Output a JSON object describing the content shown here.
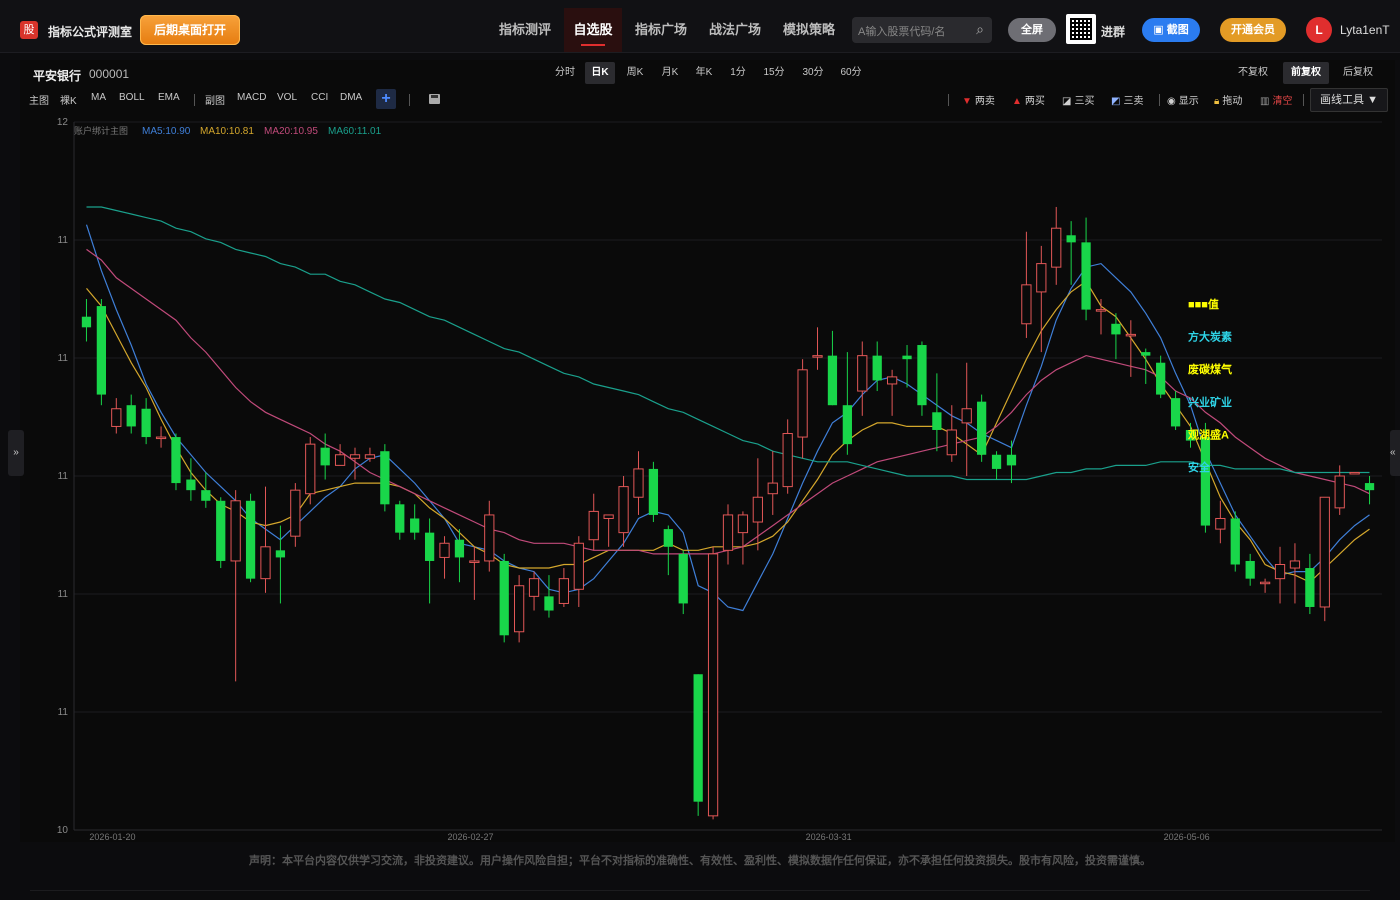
{
  "app": {
    "logo_char": "股",
    "brand": "指标公式评测室",
    "open_desktop": "后期桌面打开"
  },
  "nav": [
    {
      "label": "指标测评",
      "active": false
    },
    {
      "label": "自选股",
      "active": true
    },
    {
      "label": "指标广场",
      "active": false
    },
    {
      "label": "战法广场",
      "active": false
    },
    {
      "label": "模拟策略",
      "active": false
    }
  ],
  "search": {
    "placeholder": "A输入股票代码/名",
    "icon": "search-icon"
  },
  "buttons": {
    "fullscreen": "全屏",
    "join_group": "进群",
    "screenshot": "截图",
    "vip": "开通会员"
  },
  "user": {
    "initial": "L",
    "name": "Lyta1enT"
  },
  "stock": {
    "name": "平安银行",
    "code": "000001"
  },
  "periods": [
    "分时",
    "日K",
    "周K",
    "月K",
    "年K",
    "1分",
    "15分",
    "30分",
    "60分"
  ],
  "active_period": "日K",
  "adjust": [
    "不复权",
    "前复权",
    "后复权"
  ],
  "active_adjust": "前复权",
  "indicators_main": [
    "主图",
    "裸K",
    "MA",
    "BOLL",
    "EMA"
  ],
  "indicators_sub": [
    "副图",
    "MACD",
    "VOL",
    "CCI",
    "DMA"
  ],
  "plus": "+",
  "tools": [
    {
      "label": "两卖",
      "icon": "triangle-down-icon",
      "color": "#e02e2e"
    },
    {
      "label": "两买",
      "icon": "triangle-up-icon",
      "color": "#e02e2e"
    },
    {
      "label": "三买",
      "icon": "diagonal-line-icon",
      "color": "#ffffff"
    },
    {
      "label": "三卖",
      "icon": "diagonal-line-icon",
      "color": "#8fb3ff"
    },
    {
      "label": "显示",
      "icon": "eye-icon",
      "color": "#ffffff"
    },
    {
      "label": "拖动",
      "icon": "lock-icon",
      "color": "#f0c040"
    },
    {
      "label": "清空",
      "icon": "trash-icon",
      "color": "#e02e2e"
    }
  ],
  "draw_tools": "画线工具 ▼",
  "legend": {
    "title": "账户绑计主图",
    "ma5": "MA5:10.90",
    "ma10": "MA10:10.81",
    "ma20": "MA20:10.95",
    "ma60": "MA60:11.01"
  },
  "colors": {
    "up": "#e25757",
    "down": "#19d64a",
    "ma5": "#3f7fd8",
    "ma10": "#d4a72c",
    "ma20": "#c04a7a",
    "ma60": "#1aa08c",
    "annot_yellow": "#ffff00",
    "annot_cyan": "#2ed3e6"
  },
  "annotations": [
    {
      "text": "■■■值",
      "color": "yellow"
    },
    {
      "text": "方大炭素",
      "color": "cyan"
    },
    {
      "text": "废碳煤气",
      "color": "yellow"
    },
    {
      "text": "兴业矿业",
      "color": "cyan"
    },
    {
      "text": "观湖盛A",
      "color": "yellow"
    },
    {
      "text": "安全",
      "color": "cyan"
    }
  ],
  "chart_data": {
    "type": "candlestick",
    "y_tick_labels": [
      "12",
      "11",
      "11",
      "11",
      "11",
      "11",
      "10"
    ],
    "x_tick_labels": [
      "2026-01-20",
      "2026-02-27",
      "2026-03-31",
      "2026-05-06"
    ],
    "ylim": [
      10.0,
      12.0
    ],
    "candles": [
      {
        "o": 11.45,
        "c": 11.42,
        "h": 11.5,
        "l": 11.38
      },
      {
        "o": 11.48,
        "c": 11.23,
        "h": 11.5,
        "l": 11.2
      },
      {
        "o": 11.14,
        "c": 11.19,
        "h": 11.22,
        "l": 11.12
      },
      {
        "o": 11.2,
        "c": 11.14,
        "h": 11.23,
        "l": 11.12
      },
      {
        "o": 11.19,
        "c": 11.11,
        "h": 11.22,
        "l": 11.09
      },
      {
        "o": 11.11,
        "c": 11.11,
        "h": 11.14,
        "l": 11.08
      },
      {
        "o": 11.11,
        "c": 10.98,
        "h": 11.12,
        "l": 10.96
      },
      {
        "o": 10.99,
        "c": 10.96,
        "h": 11.05,
        "l": 10.93
      },
      {
        "o": 10.96,
        "c": 10.93,
        "h": 11.01,
        "l": 10.91
      },
      {
        "o": 10.93,
        "c": 10.76,
        "h": 10.94,
        "l": 10.74
      },
      {
        "o": 10.76,
        "c": 10.93,
        "h": 10.96,
        "l": 10.42
      },
      {
        "o": 10.93,
        "c": 10.71,
        "h": 10.95,
        "l": 10.7
      },
      {
        "o": 10.71,
        "c": 10.8,
        "h": 10.97,
        "l": 10.67
      },
      {
        "o": 10.79,
        "c": 10.77,
        "h": 10.86,
        "l": 10.64
      },
      {
        "o": 10.83,
        "c": 10.96,
        "h": 10.98,
        "l": 10.8
      },
      {
        "o": 10.95,
        "c": 11.09,
        "h": 11.11,
        "l": 10.92
      },
      {
        "o": 11.08,
        "c": 11.03,
        "h": 11.12,
        "l": 10.99
      },
      {
        "o": 11.03,
        "c": 11.06,
        "h": 11.09,
        "l": 11.03
      },
      {
        "o": 11.05,
        "c": 11.06,
        "h": 11.08,
        "l": 10.99
      },
      {
        "o": 11.05,
        "c": 11.06,
        "h": 11.08,
        "l": 11.04
      },
      {
        "o": 11.07,
        "c": 10.92,
        "h": 11.09,
        "l": 10.9
      },
      {
        "o": 10.92,
        "c": 10.84,
        "h": 10.93,
        "l": 10.82
      },
      {
        "o": 10.88,
        "c": 10.84,
        "h": 10.92,
        "l": 10.82
      },
      {
        "o": 10.84,
        "c": 10.76,
        "h": 10.88,
        "l": 10.64
      },
      {
        "o": 10.77,
        "c": 10.81,
        "h": 10.83,
        "l": 10.71
      },
      {
        "o": 10.82,
        "c": 10.77,
        "h": 10.85,
        "l": 10.7
      },
      {
        "o": 10.76,
        "c": 10.76,
        "h": 10.8,
        "l": 10.65
      },
      {
        "o": 10.76,
        "c": 10.89,
        "h": 10.93,
        "l": 10.73
      },
      {
        "o": 10.76,
        "c": 10.55,
        "h": 10.78,
        "l": 10.53
      },
      {
        "o": 10.56,
        "c": 10.69,
        "h": 10.72,
        "l": 10.53
      },
      {
        "o": 10.66,
        "c": 10.71,
        "h": 10.73,
        "l": 10.62
      },
      {
        "o": 10.66,
        "c": 10.62,
        "h": 10.72,
        "l": 10.6
      },
      {
        "o": 10.64,
        "c": 10.71,
        "h": 10.74,
        "l": 10.63
      },
      {
        "o": 10.68,
        "c": 10.81,
        "h": 10.83,
        "l": 10.63
      },
      {
        "o": 10.82,
        "c": 10.9,
        "h": 10.95,
        "l": 10.79
      },
      {
        "o": 10.88,
        "c": 10.89,
        "h": 10.89,
        "l": 10.8
      },
      {
        "o": 10.84,
        "c": 10.97,
        "h": 11.0,
        "l": 10.8
      },
      {
        "o": 10.94,
        "c": 11.02,
        "h": 11.07,
        "l": 10.89
      },
      {
        "o": 11.02,
        "c": 10.89,
        "h": 11.04,
        "l": 10.87
      },
      {
        "o": 10.85,
        "c": 10.8,
        "h": 10.86,
        "l": 10.72
      },
      {
        "o": 10.78,
        "c": 10.64,
        "h": 10.79,
        "l": 10.61
      },
      {
        "o": 10.44,
        "c": 10.08,
        "h": 10.44,
        "l": 10.04
      },
      {
        "o": 10.04,
        "c": 10.78,
        "h": 10.8,
        "l": 10.03
      },
      {
        "o": 10.79,
        "c": 10.89,
        "h": 10.92,
        "l": 10.75
      },
      {
        "o": 10.84,
        "c": 10.89,
        "h": 10.9,
        "l": 10.75
      },
      {
        "o": 10.87,
        "c": 10.94,
        "h": 11.05,
        "l": 10.79
      },
      {
        "o": 10.95,
        "c": 10.98,
        "h": 11.07,
        "l": 10.89
      },
      {
        "o": 10.97,
        "c": 11.12,
        "h": 11.16,
        "l": 10.95
      },
      {
        "o": 11.11,
        "c": 11.3,
        "h": 11.33,
        "l": 11.05
      },
      {
        "o": 11.34,
        "c": 11.34,
        "h": 11.42,
        "l": 11.3
      },
      {
        "o": 11.34,
        "c": 11.2,
        "h": 11.41,
        "l": 11.2
      },
      {
        "o": 11.2,
        "c": 11.09,
        "h": 11.35,
        "l": 11.06
      },
      {
        "o": 11.24,
        "c": 11.34,
        "h": 11.38,
        "l": 11.17
      },
      {
        "o": 11.34,
        "c": 11.27,
        "h": 11.38,
        "l": 11.24
      },
      {
        "o": 11.26,
        "c": 11.28,
        "h": 11.3,
        "l": 11.17
      },
      {
        "o": 11.34,
        "c": 11.33,
        "h": 11.37,
        "l": 11.25
      },
      {
        "o": 11.37,
        "c": 11.2,
        "h": 11.38,
        "l": 11.17
      },
      {
        "o": 11.18,
        "c": 11.13,
        "h": 11.29,
        "l": 11.07
      },
      {
        "o": 11.06,
        "c": 11.13,
        "h": 11.2,
        "l": 11.04
      },
      {
        "o": 11.15,
        "c": 11.19,
        "h": 11.32,
        "l": 11.0
      },
      {
        "o": 11.21,
        "c": 11.06,
        "h": 11.23,
        "l": 11.04
      },
      {
        "o": 11.06,
        "c": 11.02,
        "h": 11.07,
        "l": 10.99
      },
      {
        "o": 11.06,
        "c": 11.03,
        "h": 11.1,
        "l": 10.98
      },
      {
        "o": 11.43,
        "c": 11.54,
        "h": 11.69,
        "l": 11.39
      },
      {
        "o": 11.52,
        "c": 11.6,
        "h": 11.65,
        "l": 11.35
      },
      {
        "o": 11.59,
        "c": 11.7,
        "h": 11.76,
        "l": 11.54
      },
      {
        "o": 11.68,
        "c": 11.66,
        "h": 11.72,
        "l": 11.54
      },
      {
        "o": 11.66,
        "c": 11.47,
        "h": 11.73,
        "l": 11.44
      },
      {
        "o": 11.47,
        "c": 11.47,
        "h": 11.5,
        "l": 11.4
      },
      {
        "o": 11.43,
        "c": 11.4,
        "h": 11.46,
        "l": 11.33
      },
      {
        "o": 11.4,
        "c": 11.4,
        "h": 11.44,
        "l": 11.28
      },
      {
        "o": 11.35,
        "c": 11.34,
        "h": 11.36,
        "l": 11.26
      },
      {
        "o": 11.32,
        "c": 11.23,
        "h": 11.34,
        "l": 11.22
      },
      {
        "o": 11.22,
        "c": 11.14,
        "h": 11.24,
        "l": 11.13
      },
      {
        "o": 11.13,
        "c": 11.1,
        "h": 11.15,
        "l": 11.08
      },
      {
        "o": 11.11,
        "c": 10.86,
        "h": 11.15,
        "l": 10.84
      },
      {
        "o": 10.85,
        "c": 10.88,
        "h": 10.93,
        "l": 10.81
      },
      {
        "o": 10.88,
        "c": 10.75,
        "h": 10.9,
        "l": 10.73
      },
      {
        "o": 10.76,
        "c": 10.71,
        "h": 10.78,
        "l": 10.69
      },
      {
        "o": 10.7,
        "c": 10.7,
        "h": 10.71,
        "l": 10.67
      },
      {
        "o": 10.71,
        "c": 10.75,
        "h": 10.8,
        "l": 10.64
      },
      {
        "o": 10.74,
        "c": 10.76,
        "h": 10.81,
        "l": 10.64
      },
      {
        "o": 10.74,
        "c": 10.63,
        "h": 10.78,
        "l": 10.61
      },
      {
        "o": 10.63,
        "c": 10.94,
        "h": 10.94,
        "l": 10.59
      },
      {
        "o": 10.91,
        "c": 11.0,
        "h": 11.03,
        "l": 10.89
      },
      {
        "o": 11.01,
        "c": 11.01,
        "h": 11.01,
        "l": 11.01
      },
      {
        "o": 10.98,
        "c": 10.96,
        "h": 11.0,
        "l": 10.92
      }
    ],
    "ma_series": [
      {
        "name": "MA5",
        "values": [
          11.71,
          11.58,
          11.47,
          11.37,
          11.26,
          11.18,
          11.11,
          11.06,
          11.01,
          10.97,
          10.93,
          10.88,
          10.85,
          10.82,
          10.86,
          10.9,
          10.94,
          10.97,
          11.02,
          11.05,
          11.06,
          11.02,
          10.98,
          10.93,
          10.88,
          10.81,
          10.8,
          10.79,
          10.76,
          10.74,
          10.73,
          10.68,
          10.67,
          10.68,
          10.71,
          10.76,
          10.81,
          10.88,
          10.9,
          10.89,
          10.84,
          10.69,
          10.67,
          10.63,
          10.62,
          10.7,
          10.78,
          10.88,
          10.98,
          11.07,
          11.15,
          11.18,
          11.23,
          11.27,
          11.28,
          11.26,
          11.23,
          11.2,
          11.17,
          11.15,
          11.12,
          11.1,
          11.08,
          11.2,
          11.31,
          11.44,
          11.53,
          11.59,
          11.6,
          11.56,
          11.52,
          11.46,
          11.39,
          11.29,
          11.2,
          11.07,
          10.98,
          10.89,
          10.83,
          10.77,
          10.72,
          10.73,
          10.73,
          10.77,
          10.82,
          10.86,
          10.89
        ]
      },
      {
        "name": "MA10",
        "values": [
          11.53,
          11.48,
          11.4,
          11.32,
          11.25,
          11.16,
          11.08,
          11.01,
          10.96,
          10.92,
          10.9,
          10.87,
          10.86,
          10.87,
          10.89,
          10.95,
          10.96,
          10.97,
          10.98,
          10.98,
          10.98,
          10.97,
          10.95,
          10.91,
          10.88,
          10.84,
          10.8,
          10.78,
          10.75,
          10.74,
          10.74,
          10.74,
          10.75,
          10.75,
          10.77,
          10.79,
          10.79,
          10.79,
          10.79,
          10.81,
          10.79,
          10.79,
          10.8,
          10.8,
          10.8,
          10.81,
          10.83,
          10.87,
          10.93,
          10.99,
          11.06,
          11.1,
          11.13,
          11.15,
          11.15,
          11.14,
          11.14,
          11.14,
          11.12,
          11.09,
          11.06,
          11.15,
          11.24,
          11.33,
          11.41,
          11.47,
          11.52,
          11.55,
          11.48,
          11.45,
          11.39,
          11.33,
          11.26,
          11.2,
          11.14,
          11.04,
          10.94,
          10.87,
          10.82,
          10.75,
          10.73,
          10.72,
          10.7,
          10.74,
          10.78,
          10.82,
          10.85
        ]
      },
      {
        "name": "MA20",
        "values": [
          11.64,
          11.61,
          11.56,
          11.53,
          11.5,
          11.47,
          11.44,
          11.39,
          11.35,
          11.3,
          11.25,
          11.21,
          11.18,
          11.16,
          11.14,
          11.12,
          11.09,
          11.07,
          11.04,
          11.01,
          10.99,
          10.97,
          10.95,
          10.93,
          10.91,
          10.89,
          10.87,
          10.85,
          10.84,
          10.82,
          10.81,
          10.81,
          10.81,
          10.8,
          10.79,
          10.79,
          10.79,
          10.79,
          10.78,
          10.78,
          10.78,
          10.78,
          10.78,
          10.79,
          10.8,
          10.83,
          10.86,
          10.89,
          10.92,
          10.95,
          10.98,
          11.0,
          11.02,
          11.04,
          11.05,
          11.06,
          11.07,
          11.08,
          11.09,
          11.1,
          11.11,
          11.14,
          11.18,
          11.23,
          11.27,
          11.3,
          11.32,
          11.34,
          11.33,
          11.32,
          11.31,
          11.3,
          11.28,
          11.24,
          11.22,
          11.18,
          11.15,
          11.11,
          11.08,
          11.05,
          11.03,
          11.01,
          11.0,
          10.99,
          10.98,
          10.97,
          10.95
        ]
      },
      {
        "name": "MA60",
        "values": [
          11.76,
          11.76,
          11.75,
          11.74,
          11.73,
          11.72,
          11.7,
          11.69,
          11.67,
          11.66,
          11.64,
          11.63,
          11.62,
          11.6,
          11.59,
          11.57,
          11.57,
          11.55,
          11.54,
          11.52,
          11.5,
          11.49,
          11.47,
          11.45,
          11.44,
          11.42,
          11.4,
          11.38,
          11.36,
          11.35,
          11.33,
          11.31,
          11.29,
          11.28,
          11.26,
          11.25,
          11.24,
          11.23,
          11.21,
          11.19,
          11.18,
          11.16,
          11.14,
          11.12,
          11.1,
          11.09,
          11.07,
          11.06,
          11.05,
          11.04,
          11.04,
          11.04,
          11.03,
          11.02,
          11.01,
          11.0,
          11.0,
          11.0,
          11.0,
          10.99,
          10.99,
          10.99,
          10.99,
          10.99,
          11.0,
          11.01,
          11.01,
          11.02,
          11.02,
          11.03,
          11.03,
          11.03,
          11.04,
          11.04,
          11.04,
          11.03,
          11.03,
          11.02,
          11.02,
          11.02,
          11.02,
          11.01,
          11.01,
          11.01,
          11.01,
          11.01,
          11.01
        ]
      }
    ]
  },
  "footer": "声明：本平台内容仅供学习交流，非投资建议。用户操作风险自担；平台不对指标的准确性、有效性、盈利性、模拟数据作任何保证，亦不承担任何投资损失。股市有风险，投资需谨慎。"
}
